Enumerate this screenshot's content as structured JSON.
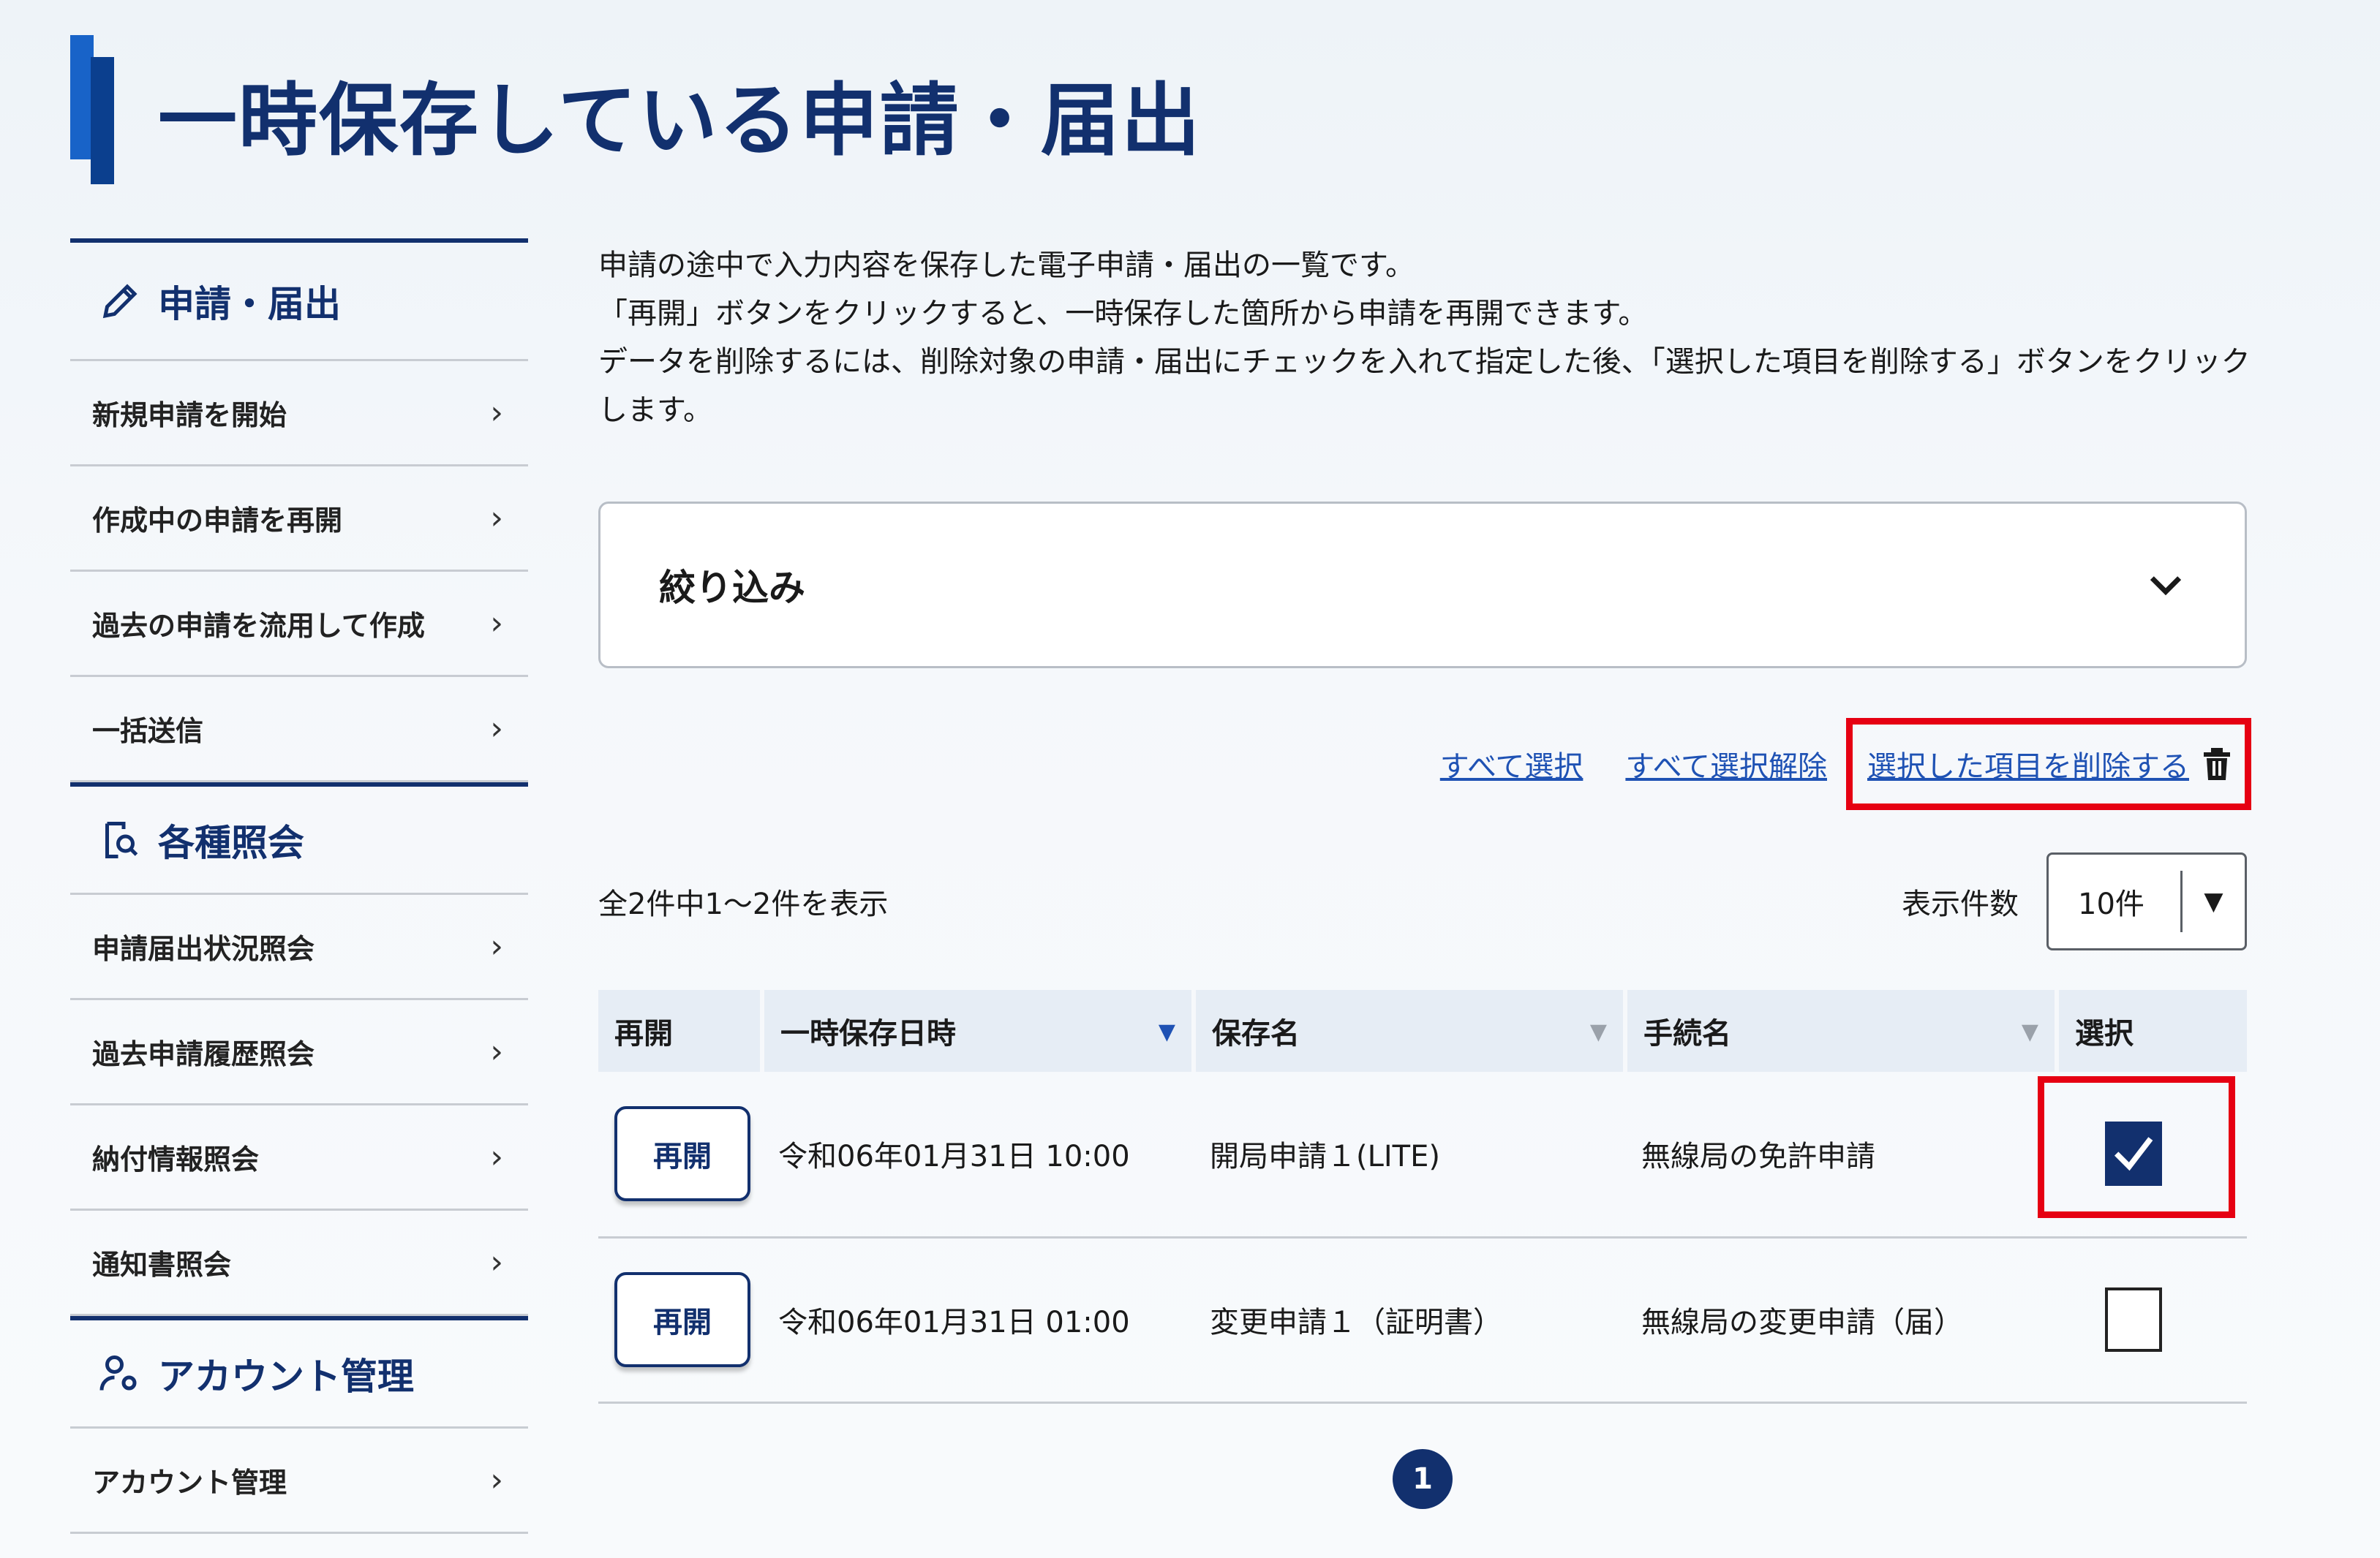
{
  "page": {
    "title": "一時保存している申請・届出"
  },
  "sidebar": {
    "sections": [
      {
        "heading": "申請・届出",
        "icon": "pencil-icon",
        "items": [
          "新規申請を開始",
          "作成中の申請を再開",
          "過去の申請を流用して作成",
          "一括送信"
        ]
      },
      {
        "heading": "各種照会",
        "icon": "document-search-icon",
        "items": [
          "申請届出状況照会",
          "過去申請履歴照会",
          "納付情報照会",
          "通知書照会"
        ]
      },
      {
        "heading": "アカウント管理",
        "icon": "user-gear-icon",
        "items": [
          "アカウント管理"
        ]
      }
    ],
    "chevron": "›"
  },
  "main": {
    "description": [
      "申請の途中で入力内容を保存した電子申請・届出の一覧です。",
      "「再開」ボタンをクリックすると、一時保存した箇所から申請を再開できます。",
      "データを削除するには、削除対象の申請・届出にチェックを入れて指定した後、「選択した項目を削除する」ボタンをクリック",
      "します。"
    ],
    "filter_label": "絞り込み",
    "actions": {
      "select_all": "すべて選択",
      "deselect_all": "すべて選択解除",
      "delete_selected": "選択した項目を削除する"
    },
    "count_text": "全2件中1〜2件を表示",
    "per_page_label": "表示件数",
    "per_page_value": "10件",
    "table": {
      "headers": [
        "再開",
        "一時保存日時",
        "保存名",
        "手続名",
        "選択"
      ],
      "resume_label": "再開",
      "rows": [
        {
          "saved_at": "令和06年01月31日 10:00",
          "save_name": "開局申請１(LITE)",
          "procedure": "無線局の免許申請",
          "selected": true
        },
        {
          "saved_at": "令和06年01月31日 01:00",
          "save_name": "変更申請１（証明書）",
          "procedure": "無線局の変更申請（届）",
          "selected": false
        }
      ]
    },
    "pagination": {
      "current": "1"
    }
  },
  "colors": {
    "primary": "#12306e",
    "accent": "#1863c8",
    "link": "#1f52b4",
    "highlight": "#e60012"
  }
}
